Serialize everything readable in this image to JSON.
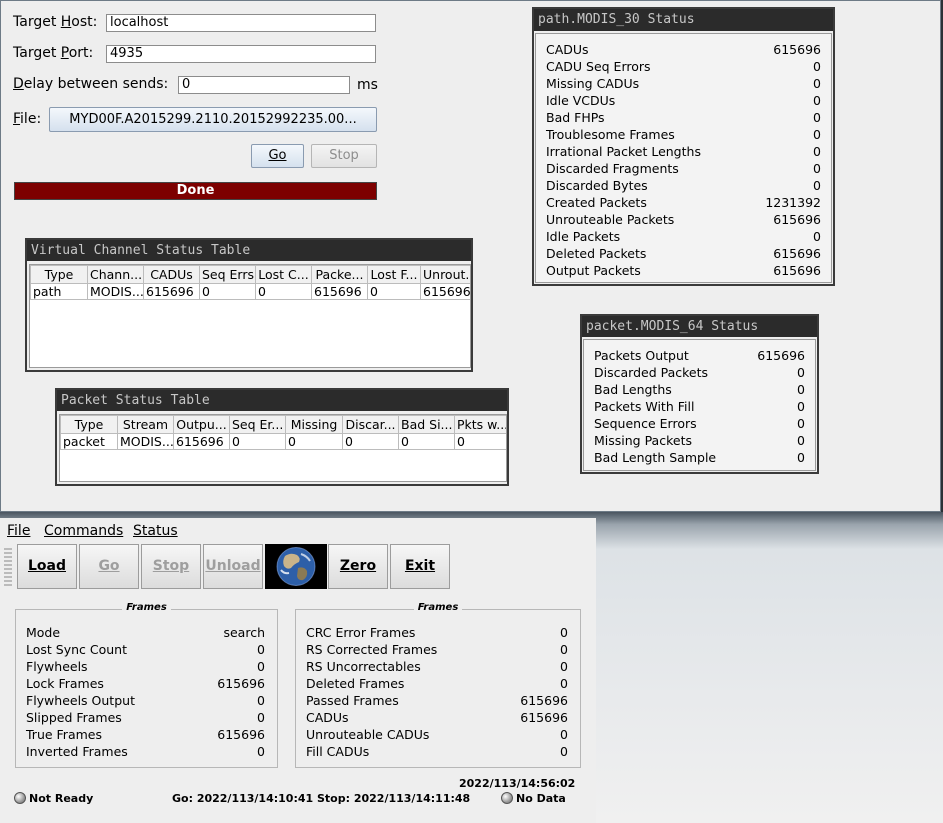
{
  "sender": {
    "target_host_label": "Target Host:",
    "target_host_value": "localhost",
    "target_port_label": "Target Port:",
    "target_port_value": "4935",
    "delay_label": "Delay between sends:",
    "delay_value": "0",
    "delay_unit": "ms",
    "file_label": "File:",
    "file_button": "MYD00F.A2015299.2110.20152992235.00...",
    "go_button": "Go",
    "stop_button": "Stop",
    "progress_text": "Done",
    "progress_color": "#7d0000"
  },
  "vc_table": {
    "title": "Virtual Channel Status Table",
    "columns": [
      "Type",
      "Chann...",
      "CADUs",
      "Seq Errs",
      "Lost C...",
      "Packe...",
      "Lost F...",
      "Unrout..."
    ],
    "rows": [
      [
        "path",
        "MODIS...",
        "615696",
        "0",
        "0",
        "615696",
        "0",
        "615696"
      ]
    ]
  },
  "packet_table": {
    "title": "Packet Status Table",
    "columns": [
      "Type",
      "Stream",
      "Outpu...",
      "Seq Er...",
      "Missing",
      "Discar...",
      "Bad Si...",
      "Pkts w..."
    ],
    "rows": [
      [
        "packet",
        "MODIS...",
        "615696",
        "0",
        "0",
        "0",
        "0",
        "0"
      ]
    ]
  },
  "path_status": {
    "title": "path.MODIS_30 Status",
    "rows": [
      {
        "label": "CADUs",
        "value": "615696"
      },
      {
        "label": "CADU Seq Errors",
        "value": "0"
      },
      {
        "label": "Missing CADUs",
        "value": "0"
      },
      {
        "label": "Idle VCDUs",
        "value": "0"
      },
      {
        "label": "Bad FHPs",
        "value": "0"
      },
      {
        "label": "Troublesome Frames",
        "value": "0"
      },
      {
        "label": "Irrational Packet Lengths",
        "value": "0"
      },
      {
        "label": "Discarded Fragments",
        "value": "0"
      },
      {
        "label": "Discarded Bytes",
        "value": "0"
      },
      {
        "label": "Created Packets",
        "value": "1231392"
      },
      {
        "label": "Unrouteable Packets",
        "value": "615696"
      },
      {
        "label": "Idle Packets",
        "value": "0"
      },
      {
        "label": "Deleted Packets",
        "value": "615696"
      },
      {
        "label": "Output Packets",
        "value": "615696"
      }
    ]
  },
  "packet_status": {
    "title": "packet.MODIS_64 Status",
    "rows": [
      {
        "label": "Packets Output",
        "value": "615696"
      },
      {
        "label": "Discarded Packets",
        "value": "0"
      },
      {
        "label": "Bad Lengths",
        "value": "0"
      },
      {
        "label": "Packets With Fill",
        "value": "0"
      },
      {
        "label": "Sequence Errors",
        "value": "0"
      },
      {
        "label": "Missing Packets",
        "value": "0"
      },
      {
        "label": "Bad Length Sample",
        "value": "0"
      }
    ]
  },
  "receiver": {
    "menu": [
      "File",
      "Commands",
      "Status"
    ],
    "toolbar": {
      "load": "Load",
      "go": "Go",
      "stop": "Stop",
      "unload": "Unload",
      "zero": "Zero",
      "exit": "Exit"
    },
    "frames_left": {
      "title": "Frames",
      "rows": [
        {
          "label": "Mode",
          "value": "search"
        },
        {
          "label": "Lost Sync Count",
          "value": "0"
        },
        {
          "label": "Flywheels",
          "value": "0"
        },
        {
          "label": "Lock Frames",
          "value": "615696"
        },
        {
          "label": "Flywheels Output",
          "value": "0"
        },
        {
          "label": "Slipped Frames",
          "value": "0"
        },
        {
          "label": "True Frames",
          "value": "615696"
        },
        {
          "label": "Inverted Frames",
          "value": "0"
        }
      ]
    },
    "frames_right": {
      "title": "Frames",
      "rows": [
        {
          "label": "CRC Error Frames",
          "value": "0"
        },
        {
          "label": "RS Corrected Frames",
          "value": "0"
        },
        {
          "label": "RS Uncorrectables",
          "value": "0"
        },
        {
          "label": "Deleted Frames",
          "value": "0"
        },
        {
          "label": "Passed Frames",
          "value": "615696"
        },
        {
          "label": "CADUs",
          "value": "615696"
        },
        {
          "label": "Unrouteable CADUs",
          "value": "0"
        },
        {
          "label": "Fill CADUs",
          "value": "0"
        }
      ]
    },
    "timestamp": "2022/113/14:56:02",
    "status_left": "Not Ready",
    "go_time": "Go: 2022/113/14:10:41",
    "stop_time": "Stop: 2022/113/14:11:48",
    "status_right": "No Data"
  }
}
